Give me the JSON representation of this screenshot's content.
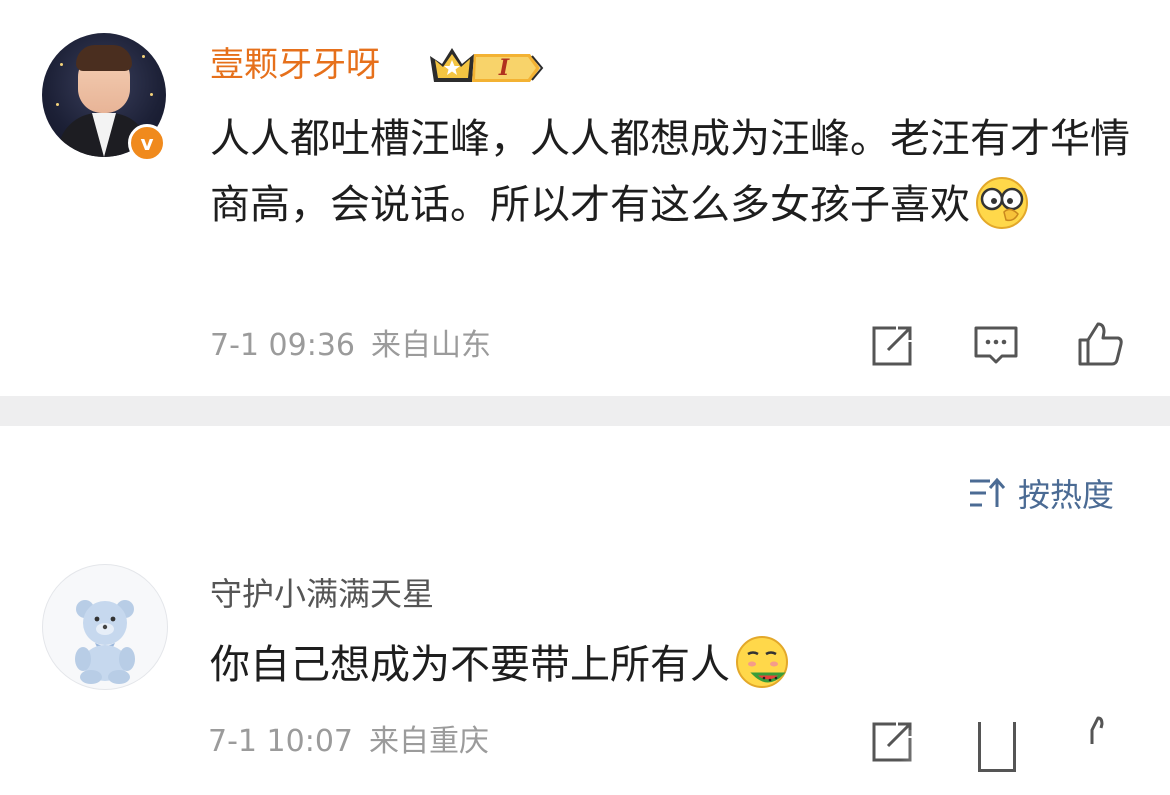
{
  "post": {
    "username": "壹颗牙牙呀",
    "level_badge": "I",
    "verified_badge": "v",
    "text": "人人都吐槽汪峰，人人都想成为汪峰。老汪有才华情商高，会说话。所以才有这么多女孩子喜欢",
    "emoji": "glasses-face-emoji",
    "time": "7-1 09:36",
    "location": "来自山东",
    "actions": [
      "share-icon",
      "comment-icon",
      "like-icon"
    ]
  },
  "sort": {
    "label": "按热度",
    "icon": "sort-icon"
  },
  "comment": {
    "username": "守护小满满天星",
    "text": "你自己想成为不要带上所有人",
    "emoji": "eating-watermelon-emoji",
    "time": "7-1 10:07",
    "location": "来自重庆"
  },
  "colors": {
    "username_orange": "#e6701b",
    "link_blue": "#4b6b94",
    "meta_gray": "#9b9b9b",
    "divider": "#eeeeef"
  }
}
